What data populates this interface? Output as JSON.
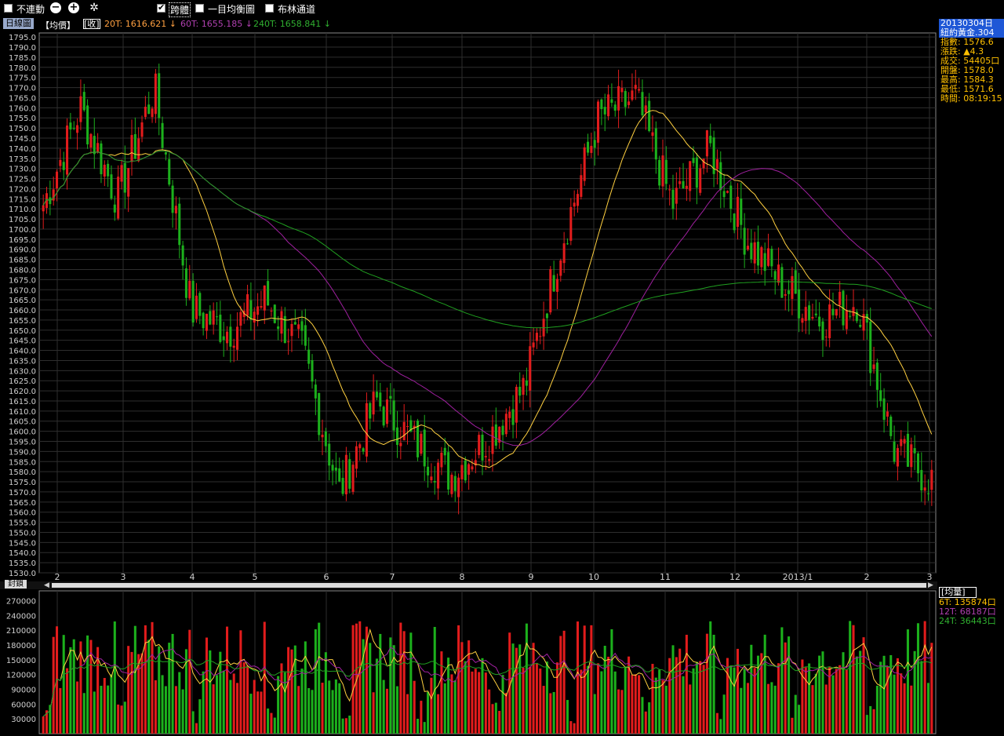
{
  "toolbar": {
    "cb1_label": "不連動",
    "cb3_label": "一目均衡圖",
    "cb4_label": "布林通道"
  },
  "ma_bar": {
    "tab_label": "日線圖",
    "ma_mode": "【均價】",
    "price_mode": "[收]",
    "ma20": "20T: 1616.621 ↓",
    "ma60": "60T: 1655.185 ↓",
    "ma240": "240T: 1658.841 ↓"
  },
  "info_panel": {
    "date": "20130304日",
    "symbol": "紐約黃金.304",
    "rows": [
      "指數: 1576.6",
      "漲跌: ▲4.3",
      "成交: 54405口",
      "開盤: 1578.0",
      "最高: 1584.3",
      "最低: 1571.6",
      "時間: 08:19:15"
    ]
  },
  "volume_info": {
    "title": "[均量]",
    "rows": [
      "6T: 135874口",
      "12T: 68187口",
      "24T: 36443口"
    ]
  },
  "scroll_label": "封鎖",
  "colors": {
    "up": "#e21c1c",
    "down": "#1cb01c",
    "ma20": "#ffd040",
    "ma60": "#a020a0",
    "ma240": "#20a020",
    "grid": "#2e2e2e",
    "axis": "#cfcfcf"
  },
  "chart_data": {
    "type": "candlestick",
    "price_axis": {
      "ylim": [
        1530,
        1797
      ],
      "ticks": [
        1530,
        1535,
        1540,
        1545,
        1550,
        1555,
        1560,
        1565,
        1570,
        1575,
        1580,
        1585,
        1590,
        1595,
        1600,
        1605,
        1610,
        1615,
        1620,
        1625,
        1630,
        1635,
        1640,
        1645,
        1650,
        1655,
        1660,
        1665,
        1670,
        1675,
        1680,
        1685,
        1690,
        1695,
        1700,
        1705,
        1710,
        1715,
        1720,
        1725,
        1730,
        1735,
        1740,
        1745,
        1750,
        1755,
        1760,
        1765,
        1770,
        1775,
        1780,
        1785,
        1790,
        1795
      ]
    },
    "x_labels": [
      "2",
      "3",
      "4",
      "5",
      "6",
      "7",
      "8",
      "9",
      "10",
      "11",
      "12",
      "2013/1",
      "2",
      "3"
    ],
    "close_anchors": [
      1712,
      1760,
      1715,
      1770,
      1660,
      1650,
      1665,
      1640,
      1570,
      1615,
      1595,
      1578,
      1596,
      1622,
      1693,
      1755,
      1765,
      1712,
      1740,
      1695,
      1672,
      1655,
      1665,
      1590,
      1576
    ],
    "volume_axis": {
      "ylim": [
        0,
        290000
      ],
      "ticks": [
        30000,
        60000,
        90000,
        120000,
        150000,
        180000,
        210000,
        240000,
        270000
      ]
    }
  }
}
